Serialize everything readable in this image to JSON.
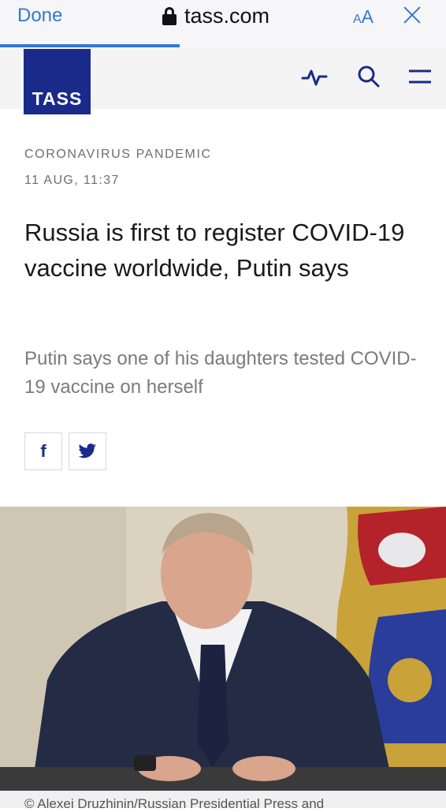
{
  "browser": {
    "done_label": "Done",
    "url": "tass.com",
    "text_size_label_small": "A",
    "text_size_label_large": "A",
    "lock_icon": "lock-icon",
    "close_icon": "close-icon"
  },
  "header": {
    "logo_text": "TASS",
    "icons": [
      "pulse-icon",
      "search-icon",
      "menu-icon"
    ],
    "brand_color": "#1a2a8a"
  },
  "article": {
    "category": "CORONAVIRUS PANDEMIC",
    "date": "11 AUG, 11:37",
    "headline": "Russia is first to register COVID-19 vaccine worldwide, Putin says",
    "subheadline": "Putin says one of his daughters tested COVID-19 vaccine on herself",
    "share": {
      "facebook_label": "f",
      "twitter_icon": "twitter-icon"
    },
    "photo_caption": "© Alexei Druzhinin/Russian Presidential Press and"
  }
}
